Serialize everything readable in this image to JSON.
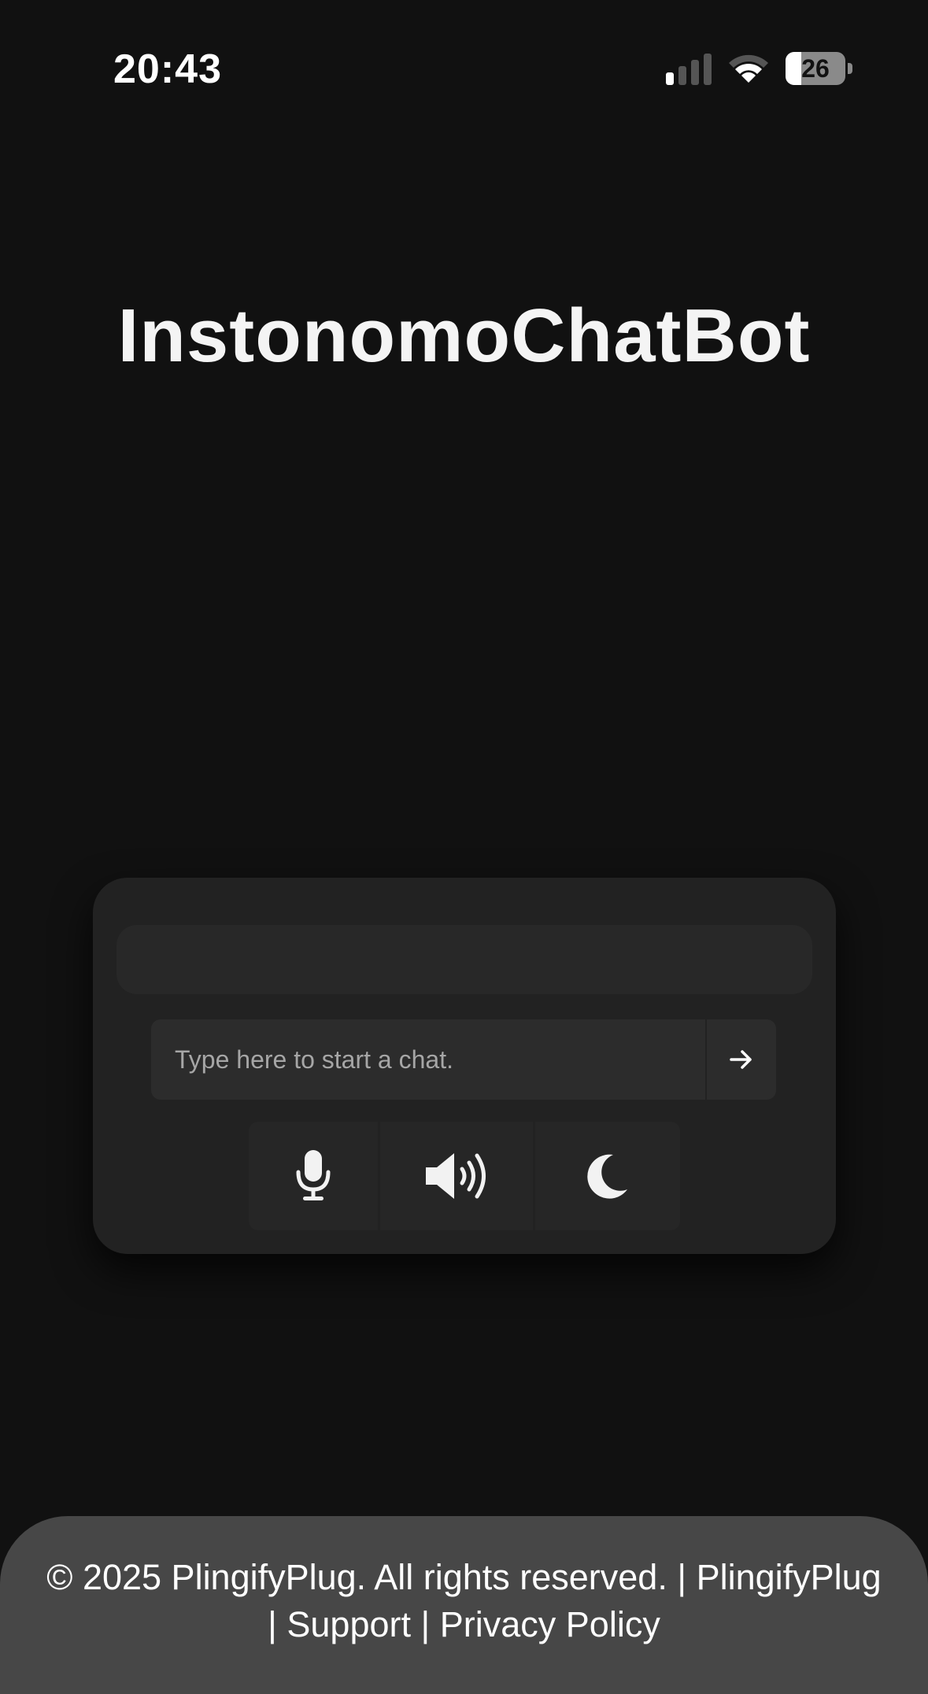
{
  "status_bar": {
    "time": "20:43",
    "battery_level": "26",
    "battery_fraction": 0.26
  },
  "app": {
    "title": "InstonomoChatBot"
  },
  "chat": {
    "input_placeholder": "Type here to start a chat.",
    "input_value": "",
    "send_icon": "arrow-right-icon",
    "controls": [
      {
        "name": "microphone",
        "icon": "microphone-icon"
      },
      {
        "name": "speaker",
        "icon": "speaker-volume-icon"
      },
      {
        "name": "dark-mode",
        "icon": "moon-icon"
      }
    ]
  },
  "footer": {
    "copyright": "© 2025 PlingifyPlug. All rights reserved.",
    "separator": "|",
    "links": [
      "PlingifyPlug",
      "Support",
      "Privacy Policy"
    ]
  },
  "colors": {
    "background": "#111111",
    "card": "#222222",
    "input": "#2c2c2c",
    "footer": "#474747",
    "text": "#ffffff"
  }
}
